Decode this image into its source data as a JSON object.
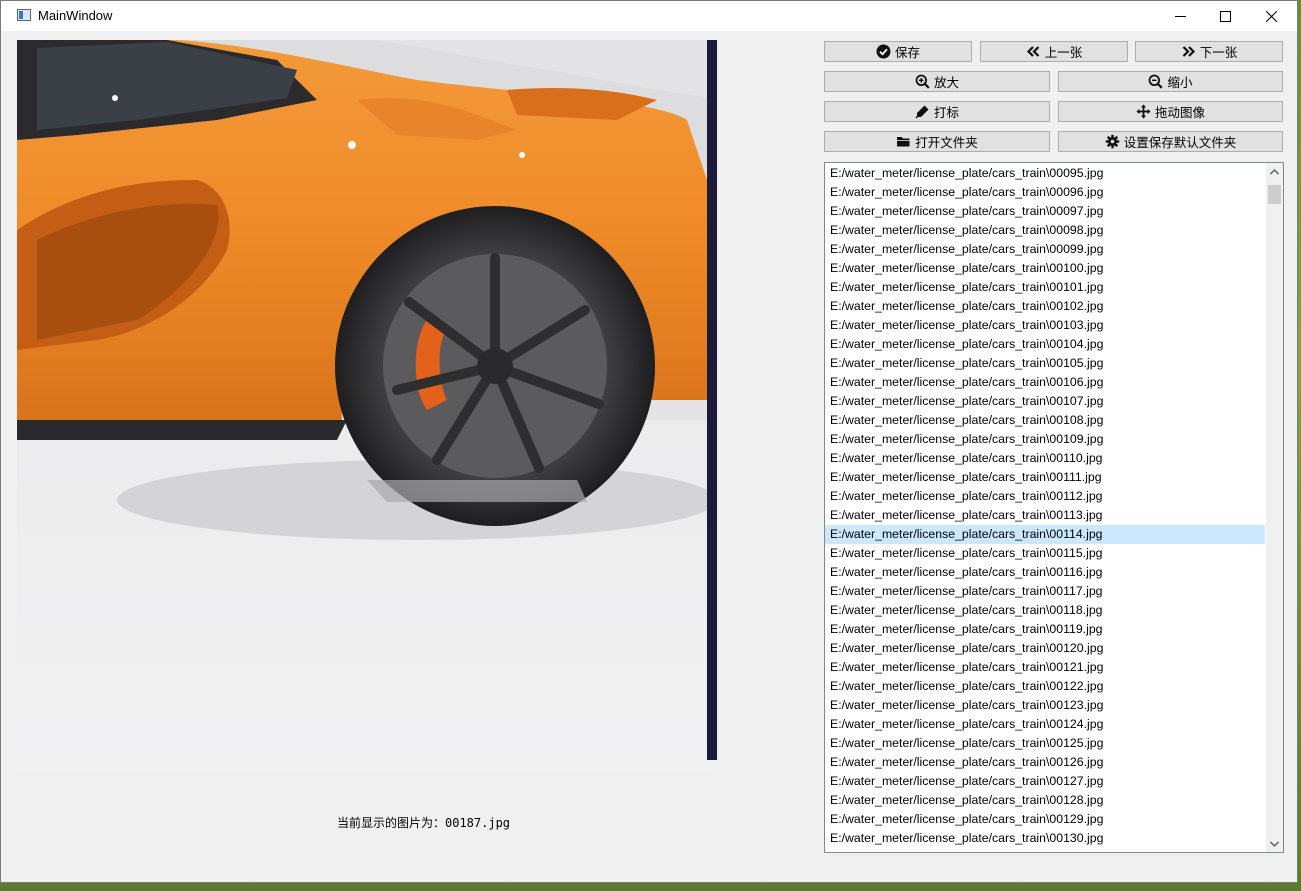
{
  "window": {
    "title": "MainWindow"
  },
  "toolbar": {
    "save": "保存",
    "prev": "上一张",
    "next": "下一张",
    "zoom_in": "放大",
    "zoom_out": "缩小",
    "annotate": "打标",
    "drag": "拖动图像",
    "open_folder": "打开文件夹",
    "set_default_folder": "设置保存默认文件夹"
  },
  "status": {
    "text": "当前显示的图片为：00187.jpg"
  },
  "file_list": {
    "selected_index": 19,
    "items": [
      "E:/water_meter/license_plate/cars_train\\00095.jpg",
      "E:/water_meter/license_plate/cars_train\\00096.jpg",
      "E:/water_meter/license_plate/cars_train\\00097.jpg",
      "E:/water_meter/license_plate/cars_train\\00098.jpg",
      "E:/water_meter/license_plate/cars_train\\00099.jpg",
      "E:/water_meter/license_plate/cars_train\\00100.jpg",
      "E:/water_meter/license_plate/cars_train\\00101.jpg",
      "E:/water_meter/license_plate/cars_train\\00102.jpg",
      "E:/water_meter/license_plate/cars_train\\00103.jpg",
      "E:/water_meter/license_plate/cars_train\\00104.jpg",
      "E:/water_meter/license_plate/cars_train\\00105.jpg",
      "E:/water_meter/license_plate/cars_train\\00106.jpg",
      "E:/water_meter/license_plate/cars_train\\00107.jpg",
      "E:/water_meter/license_plate/cars_train\\00108.jpg",
      "E:/water_meter/license_plate/cars_train\\00109.jpg",
      "E:/water_meter/license_plate/cars_train\\00110.jpg",
      "E:/water_meter/license_plate/cars_train\\00111.jpg",
      "E:/water_meter/license_plate/cars_train\\00112.jpg",
      "E:/water_meter/license_plate/cars_train\\00113.jpg",
      "E:/water_meter/license_plate/cars_train\\00114.jpg",
      "E:/water_meter/license_plate/cars_train\\00115.jpg",
      "E:/water_meter/license_plate/cars_train\\00116.jpg",
      "E:/water_meter/license_plate/cars_train\\00117.jpg",
      "E:/water_meter/license_plate/cars_train\\00118.jpg",
      "E:/water_meter/license_plate/cars_train\\00119.jpg",
      "E:/water_meter/license_plate/cars_train\\00120.jpg",
      "E:/water_meter/license_plate/cars_train\\00121.jpg",
      "E:/water_meter/license_plate/cars_train\\00122.jpg",
      "E:/water_meter/license_plate/cars_train\\00123.jpg",
      "E:/water_meter/license_plate/cars_train\\00124.jpg",
      "E:/water_meter/license_plate/cars_train\\00125.jpg",
      "E:/water_meter/license_plate/cars_train\\00126.jpg",
      "E:/water_meter/license_plate/cars_train\\00127.jpg",
      "E:/water_meter/license_plate/cars_train\\00128.jpg",
      "E:/water_meter/license_plate/cars_train\\00129.jpg",
      "E:/water_meter/license_plate/cars_train\\00130.jpg"
    ]
  },
  "icons": {
    "save": "check-circle-icon",
    "prev": "double-chevron-left-icon",
    "next": "double-chevron-right-icon",
    "zoom_in": "zoom-in-icon",
    "zoom_out": "zoom-out-icon",
    "annotate": "marker-icon",
    "drag": "move-icon",
    "open_folder": "folder-icon",
    "settings": "gear-icon"
  },
  "colors": {
    "selection": "#cce8ff",
    "car_body": "#f08b2a",
    "window_bg": "#f0f0f0"
  }
}
